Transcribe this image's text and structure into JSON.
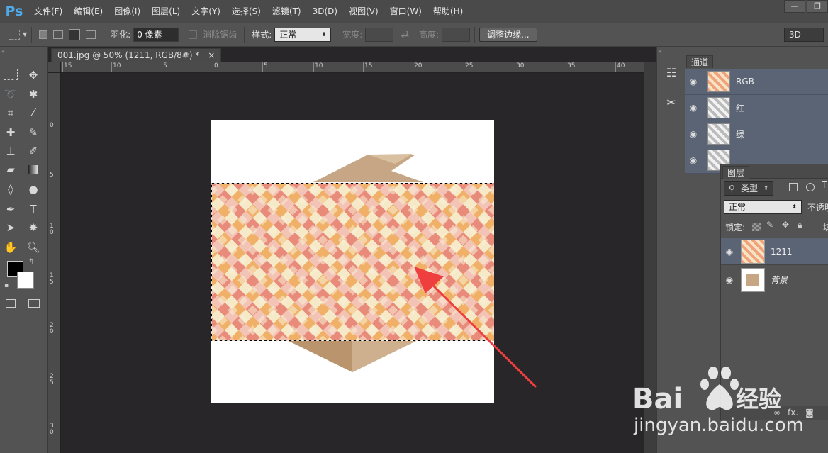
{
  "app": {
    "logo": "Ps"
  },
  "menu": [
    "文件(F)",
    "编辑(E)",
    "图像(I)",
    "图层(L)",
    "文字(Y)",
    "选择(S)",
    "滤镜(T)",
    "3D(D)",
    "视图(V)",
    "窗口(W)",
    "帮助(H)"
  ],
  "options_bar": {
    "feather_label": "羽化:",
    "feather_value": "0 像素",
    "antialias_label": "消除锯齿",
    "style_label": "样式:",
    "style_value": "正常",
    "width_label": "宽度:",
    "height_label": "高度:",
    "refine_button": "调整边缘...",
    "workspace": "3D"
  },
  "document": {
    "tab_title": "001.jpg @ 50% (1211, RGB/8#) *",
    "tab_close": "×"
  },
  "ruler_top": [
    "15",
    "10",
    "5",
    "0",
    "5",
    "10",
    "15",
    "20",
    "25",
    "30",
    "35",
    "40"
  ],
  "ruler_left": [
    "0",
    "5",
    "10",
    "15",
    "20",
    "25",
    "30"
  ],
  "channels": {
    "tab": "通道",
    "rows": [
      {
        "label": "RGB"
      },
      {
        "label": "红"
      },
      {
        "label": "绿"
      },
      {
        "label": ""
      }
    ]
  },
  "layers": {
    "tab": "图层",
    "filter_kind": "类型",
    "blend_mode": "正常",
    "opacity_label": "不透明",
    "lock_label": "锁定:",
    "fill_label": "填",
    "items": [
      {
        "name": "1211",
        "selected": true
      },
      {
        "name": "背景",
        "selected": false
      }
    ],
    "footer": "fx."
  },
  "watermark": {
    "brand": "Bai",
    "brand_cn": "经验",
    "url": "jingyan.baidu.com"
  },
  "colors": {
    "accent": "#4fa9e8",
    "arrow": "#ee3e3e",
    "selected_row": "#5b6475"
  }
}
